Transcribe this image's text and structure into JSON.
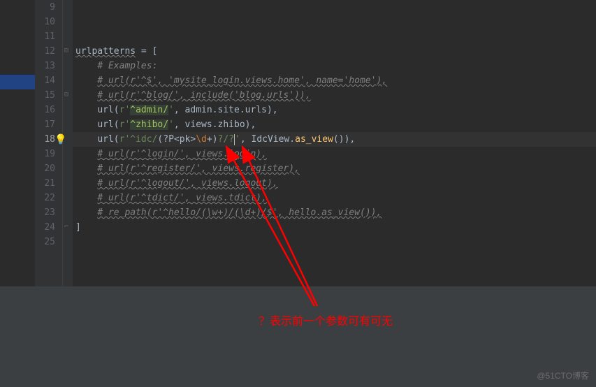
{
  "gutter": {
    "start": 9,
    "end": 25,
    "current": 18
  },
  "code": {
    "lines": [
      {
        "type": "blank",
        "content": ""
      },
      {
        "type": "blank",
        "content": ""
      },
      {
        "type": "blank",
        "content": ""
      },
      {
        "type": "assign",
        "indent": "",
        "ident": "urlpatterns",
        "rest": " = ["
      },
      {
        "type": "comment",
        "indent": "    ",
        "text": "# Examples:"
      },
      {
        "type": "comment",
        "indent": "    ",
        "text": "# url(r'^$', 'mysite_login.views.home', name='home'),"
      },
      {
        "type": "comment",
        "indent": "    ",
        "text": "# url(r'^blog/', include('blog.urls')),"
      },
      {
        "type": "url1",
        "indent": "    ",
        "prefix": "url(",
        "raw": "r'",
        "hl": "^admin/",
        "close": "'",
        "after": ", admin.site.urls),"
      },
      {
        "type": "url1",
        "indent": "    ",
        "prefix": "url(",
        "raw": "r'",
        "hl": "^zhibo/",
        "close": "'",
        "after": ", views.zhibo),"
      },
      {
        "type": "url2",
        "indent": "    ",
        "prefix": "url(",
        "raw": "r'",
        "p1": "^idc/",
        "p2": "(?P<pk>",
        "p3": "\\d",
        "p4": "+)",
        "p5": "?",
        "p6": "/",
        "p7": "?",
        "close": "'",
        "after1": ", IdcView.",
        "after2": "as_view",
        "after3": "()),"
      },
      {
        "type": "comment",
        "indent": "    ",
        "text": "# url(r'^login/', views.login),"
      },
      {
        "type": "comment",
        "indent": "    ",
        "text": "# url(r'^register/', views.register),"
      },
      {
        "type": "comment",
        "indent": "    ",
        "text": "# url(r'^logout/', views.logout),"
      },
      {
        "type": "comment",
        "indent": "    ",
        "text": "# url(r'^tdict/', views.tdict),"
      },
      {
        "type": "comment",
        "indent": "    ",
        "text": "# re_path(r'^hello/(\\w+)/(\\d+)/$', hello.as_view()),"
      },
      {
        "type": "close",
        "indent": "",
        "text": "]"
      },
      {
        "type": "blank",
        "content": ""
      }
    ]
  },
  "annotation": {
    "text": "？表示前一个参数可有可无"
  },
  "watermark": "@51CTO博客"
}
